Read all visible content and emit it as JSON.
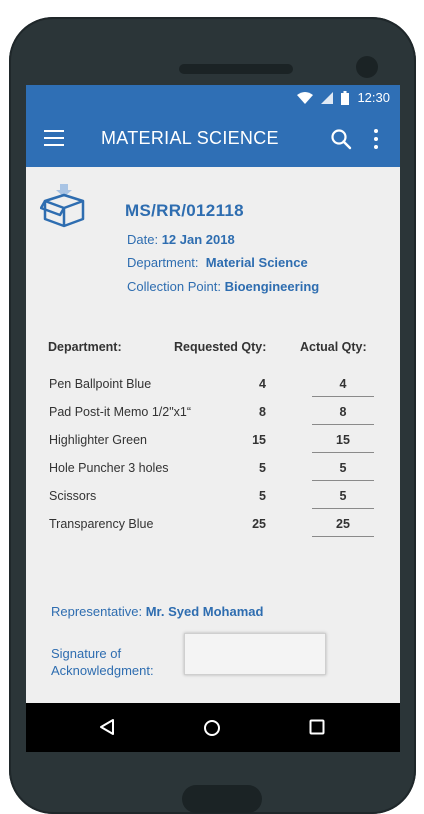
{
  "status": {
    "time": "12:30"
  },
  "appbar": {
    "title": "MATERIAL SCIENCE"
  },
  "doc": {
    "id": "MS/RR/012118",
    "date_label": "Date:",
    "date_value": "12 Jan 2018",
    "department_label": "Department:",
    "department_value": "Material Science",
    "collection_label": "Collection Point:",
    "collection_value": "Bioengineering"
  },
  "table": {
    "headers": {
      "department": "Department:",
      "requested": "Requested Qty:",
      "actual": "Actual Qty:"
    },
    "rows": [
      {
        "name": "Pen Ballpoint Blue",
        "requested": "4",
        "actual": "4"
      },
      {
        "name": "Pad Post-it Memo 1/2\"x1“",
        "requested": "8",
        "actual": "8"
      },
      {
        "name": "Highlighter Green",
        "requested": "15",
        "actual": "15"
      },
      {
        "name": "Hole Puncher 3 holes",
        "requested": "5",
        "actual": "5"
      },
      {
        "name": "Scissors",
        "requested": "5",
        "actual": "5"
      },
      {
        "name": "Transparency Blue",
        "requested": "25",
        "actual": "25"
      }
    ]
  },
  "representative": {
    "label": "Representative:",
    "value": "Mr. Syed Mohamad"
  },
  "signature": {
    "label": "Signature of Acknowledgment:"
  },
  "icons": {
    "menu": "hamburger-menu-icon",
    "search": "search-icon",
    "more": "more-vert-icon",
    "box": "box-icon",
    "wifi": "wifi-icon",
    "signal": "signal-icon",
    "battery": "battery-icon",
    "back": "back-triangle-icon",
    "home": "home-circle-icon",
    "recent": "recent-square-icon"
  },
  "colors": {
    "accent": "#2f6fb5",
    "text_blue": "#2e6db0"
  }
}
